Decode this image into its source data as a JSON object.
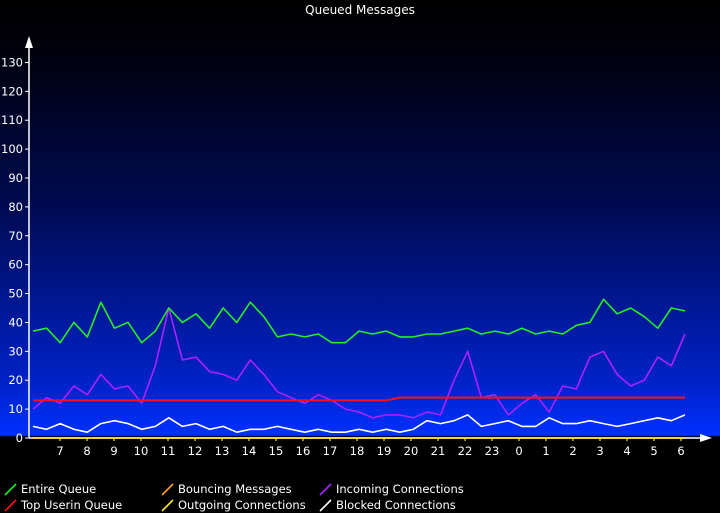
{
  "chart_data": {
    "type": "line",
    "title": "Queued Messages",
    "xlabel": "",
    "ylabel": "",
    "ylim": [
      0,
      135
    ],
    "y_ticks": [
      0,
      10,
      20,
      30,
      40,
      50,
      60,
      70,
      80,
      90,
      100,
      110,
      120,
      130
    ],
    "x_tick_labels": [
      "7",
      "8",
      "9",
      "10",
      "11",
      "12",
      "13",
      "14",
      "15",
      "16",
      "17",
      "18",
      "19",
      "20",
      "21",
      "22",
      "23",
      "0",
      "1",
      "2",
      "3",
      "4",
      "5",
      "6"
    ],
    "x": [
      0,
      0.5,
      1,
      1.5,
      2,
      2.5,
      3,
      3.5,
      4,
      4.5,
      5,
      5.5,
      6,
      6.5,
      7,
      7.5,
      8,
      8.5,
      9,
      9.5,
      10,
      10.5,
      11,
      11.5,
      12,
      12.5,
      13,
      13.5,
      14,
      14.5,
      15,
      15.5,
      16,
      16.5,
      17,
      17.5,
      18,
      18.5,
      19,
      19.5,
      20,
      20.5,
      21,
      21.5,
      22,
      22.5,
      23,
      23.5,
      24
    ],
    "grid": false,
    "legend_position": "bottom",
    "series": [
      {
        "name": "Entire Queue",
        "color": "#22ee22",
        "values": [
          37,
          38,
          33,
          40,
          35,
          47,
          38,
          40,
          33,
          37,
          45,
          40,
          43,
          38,
          45,
          40,
          47,
          42,
          35,
          36,
          35,
          36,
          33,
          33,
          37,
          36,
          37,
          35,
          35,
          36,
          36,
          37,
          38,
          36,
          37,
          36,
          38,
          36,
          37,
          36,
          39,
          40,
          48,
          43,
          45,
          42,
          38,
          45,
          44
        ]
      },
      {
        "name": "Top Userin Queue",
        "color": "#ff1010",
        "values": [
          13,
          13,
          13,
          13,
          13,
          13,
          13,
          13,
          13,
          13,
          13,
          13,
          13,
          13,
          13,
          13,
          13,
          13,
          13,
          13,
          13,
          13,
          13,
          13,
          13,
          13,
          13,
          14,
          14,
          14,
          14,
          14,
          14,
          14,
          14,
          14,
          14,
          14,
          14,
          14,
          14,
          14,
          14,
          14,
          14,
          14,
          14,
          14,
          14
        ]
      },
      {
        "name": "Bouncing Messages",
        "color": "#ffa020",
        "values": [
          0,
          0,
          0,
          0,
          0,
          0,
          0,
          0,
          0,
          0,
          0,
          0,
          0,
          0,
          0,
          0,
          0,
          0,
          0,
          0,
          0,
          0,
          0,
          0,
          0,
          0,
          0,
          0,
          0,
          0,
          0,
          0,
          0,
          0,
          0,
          0,
          0,
          0,
          0,
          0,
          0,
          0,
          0,
          0,
          0,
          0,
          0,
          0,
          0
        ]
      },
      {
        "name": "Outgoing Connections",
        "color": "#ffee20",
        "values": [
          0,
          0,
          0,
          0,
          0,
          0,
          0,
          0,
          0,
          0,
          0,
          0,
          0,
          0,
          0,
          0,
          0,
          0,
          0,
          0,
          0,
          0,
          0,
          0,
          0,
          0,
          0,
          0,
          0,
          0,
          0,
          0,
          0,
          0,
          0,
          0,
          0,
          0,
          0,
          0,
          0,
          0,
          0,
          0,
          0,
          0,
          0,
          0,
          0
        ]
      },
      {
        "name": "Incoming Connections",
        "color": "#aa22ff",
        "values": [
          10,
          14,
          12,
          18,
          15,
          22,
          17,
          18,
          12,
          25,
          45,
          27,
          28,
          23,
          22,
          20,
          27,
          22,
          16,
          14,
          12,
          15,
          13,
          10,
          9,
          7,
          8,
          8,
          7,
          9,
          8,
          20,
          30,
          14,
          15,
          8,
          12,
          15,
          9,
          18,
          17,
          28,
          30,
          22,
          18,
          20,
          28,
          25,
          36
        ]
      },
      {
        "name": "Blocked Connections",
        "color": "#ffffff",
        "values": [
          4,
          3,
          5,
          3,
          2,
          5,
          6,
          5,
          3,
          4,
          7,
          4,
          5,
          3,
          4,
          2,
          3,
          3,
          4,
          3,
          2,
          3,
          2,
          2,
          3,
          2,
          3,
          2,
          3,
          6,
          5,
          6,
          8,
          4,
          5,
          6,
          4,
          4,
          7,
          5,
          5,
          6,
          5,
          4,
          5,
          6,
          7,
          6,
          8
        ]
      }
    ]
  }
}
